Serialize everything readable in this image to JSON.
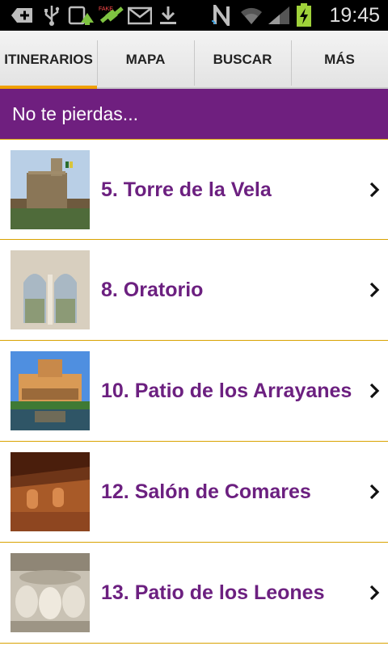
{
  "status_bar": {
    "time": "19:45",
    "icons": [
      "add-notification-icon",
      "usb-icon",
      "upload-icon",
      "satellite-icon",
      "gmail-icon",
      "download-icon",
      "nfc-icon",
      "wifi-icon",
      "signal-icon",
      "battery-charging-icon"
    ]
  },
  "tabs": [
    {
      "label": "ITINERARIOS",
      "active": true
    },
    {
      "label": "MAPA",
      "active": false
    },
    {
      "label": "BUSCAR",
      "active": false
    },
    {
      "label": "MÁS",
      "active": false
    }
  ],
  "banner": {
    "text": "No te pierdas..."
  },
  "items": [
    {
      "label": "5. Torre de la Vela",
      "image": "torre-de-la-vela-photo"
    },
    {
      "label": "8. Oratorio",
      "image": "oratorio-photo"
    },
    {
      "label": "10. Patio de los Arrayanes",
      "image": "patio-de-los-arrayanes-photo"
    },
    {
      "label": "12. Salón de Comares",
      "image": "salon-de-comares-photo"
    },
    {
      "label": "13. Patio de los Leones",
      "image": "patio-de-los-leones-photo"
    }
  ],
  "colors": {
    "accent": "#f0a000",
    "banner": "#6f1f7f",
    "item_text": "#6c2080",
    "divider": "#d9a200"
  }
}
